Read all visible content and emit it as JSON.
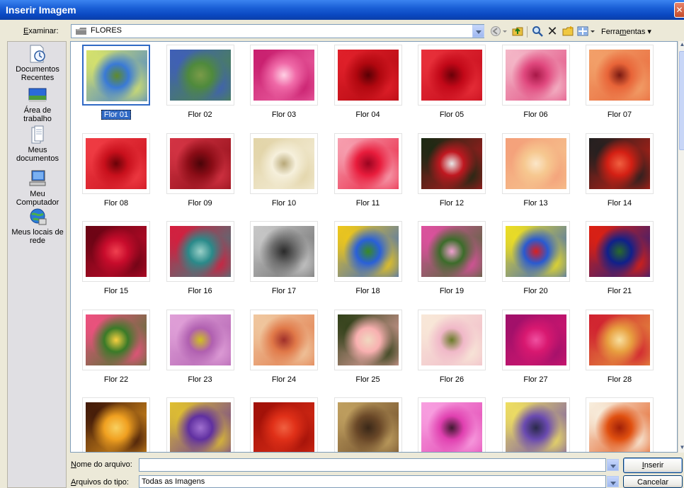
{
  "window": {
    "title": "Inserir Imagem",
    "close_glyph": "✕"
  },
  "toolbar": {
    "look_in_label": "Examinar:",
    "look_in_underline": "E",
    "look_in_rest": "xaminar:",
    "current_folder": "FLORES",
    "tools_label": "Ferramentas",
    "tools_pre": "Ferra",
    "tools_underline": "m",
    "tools_post": "entas ▾",
    "delete_glyph": "✕"
  },
  "places": [
    {
      "line1": "Documentos",
      "line2": "Recentes",
      "icon": "recent-documents-icon"
    },
    {
      "line1": "Área de",
      "line2": "trabalho",
      "icon": "desktop-icon"
    },
    {
      "line1": "Meus",
      "line2": "documentos",
      "icon": "my-documents-icon"
    },
    {
      "line1": "Meu",
      "line2": "Computador",
      "icon": "my-computer-icon"
    },
    {
      "line1": "Meus locais de",
      "line2": "rede",
      "icon": "network-places-icon"
    }
  ],
  "files": [
    {
      "name": "Flor 01",
      "selected": true,
      "colors": [
        "#3a7ad6",
        "#d8e36a",
        "#5f8a2a"
      ]
    },
    {
      "name": "Flor 02",
      "selected": false,
      "colors": [
        "#4f8a3c",
        "#3f5fb8",
        "#7a9b48"
      ]
    },
    {
      "name": "Flor 03",
      "selected": false,
      "colors": [
        "#f06aa8",
        "#c81e6e",
        "#ffd0e4"
      ]
    },
    {
      "name": "Flor 04",
      "selected": false,
      "colors": [
        "#b0070f",
        "#e0202a",
        "#5a0005"
      ]
    },
    {
      "name": "Flor 05",
      "selected": false,
      "colors": [
        "#c20818",
        "#e8303a",
        "#6a0008"
      ]
    },
    {
      "name": "Flor 06",
      "selected": false,
      "colors": [
        "#e0487e",
        "#f4b8c8",
        "#a81848"
      ]
    },
    {
      "name": "Flor 07",
      "selected": false,
      "colors": [
        "#e86438",
        "#f2a16a",
        "#7a1a12"
      ]
    },
    {
      "name": "Flor 08",
      "selected": false,
      "colors": [
        "#c8101c",
        "#f03c44",
        "#6a0208"
      ]
    },
    {
      "name": "Flor 09",
      "selected": false,
      "colors": [
        "#8a0c16",
        "#d43444",
        "#4a0408"
      ]
    },
    {
      "name": "Flor 10",
      "selected": false,
      "colors": [
        "#f6f0dc",
        "#e2d4a8",
        "#b8a878"
      ]
    },
    {
      "name": "Flor 11",
      "selected": false,
      "colors": [
        "#e81c3c",
        "#f6a0b0",
        "#9a0420"
      ]
    },
    {
      "name": "Flor 12",
      "selected": false,
      "colors": [
        "#c01820",
        "#1a2a14",
        "#e8e8e8"
      ]
    },
    {
      "name": "Flor 13",
      "selected": false,
      "colors": [
        "#f6c890",
        "#f4a07a",
        "#fbe6c8"
      ]
    },
    {
      "name": "Flor 14",
      "selected": false,
      "colors": [
        "#d42014",
        "#202020",
        "#f06040"
      ]
    },
    {
      "name": "Flor 15",
      "selected": false,
      "colors": [
        "#c80c2c",
        "#6a0414",
        "#f04050"
      ]
    },
    {
      "name": "Flor 16",
      "selected": false,
      "colors": [
        "#2a8a8a",
        "#d81c3c",
        "#9ad0c8"
      ]
    },
    {
      "name": "Flor 17",
      "selected": false,
      "colors": [
        "#6a6a6a",
        "#c8c8c8",
        "#2a2a2a"
      ]
    },
    {
      "name": "Flor 18",
      "selected": false,
      "colors": [
        "#2a60d8",
        "#f0c818",
        "#3a8a24"
      ]
    },
    {
      "name": "Flor 19",
      "selected": false,
      "colors": [
        "#3c6c2a",
        "#e050a0",
        "#f0a0d0"
      ]
    },
    {
      "name": "Flor 20",
      "selected": false,
      "colors": [
        "#2a5ad0",
        "#f0e020",
        "#d82020"
      ]
    },
    {
      "name": "Flor 21",
      "selected": false,
      "colors": [
        "#10208a",
        "#e02010",
        "#2a6a2a"
      ]
    },
    {
      "name": "Flor 22",
      "selected": false,
      "colors": [
        "#3a7a28",
        "#f05080",
        "#f8d040"
      ]
    },
    {
      "name": "Flor 23",
      "selected": false,
      "colors": [
        "#b060b0",
        "#e0a0d8",
        "#d0c020"
      ]
    },
    {
      "name": "Flor 24",
      "selected": false,
      "colors": [
        "#e07848",
        "#f0c8a0",
        "#a0302a"
      ]
    },
    {
      "name": "Flor 25",
      "selected": false,
      "colors": [
        "#f8b0b0",
        "#304018",
        "#f0d8c0"
      ]
    },
    {
      "name": "Flor 26",
      "selected": false,
      "colors": [
        "#f0b8c8",
        "#f8e8d8",
        "#6a7a28"
      ]
    },
    {
      "name": "Flor 27",
      "selected": false,
      "colors": [
        "#d81870",
        "#a0106a",
        "#f050a0"
      ]
    },
    {
      "name": "Flor 28",
      "selected": false,
      "colors": [
        "#e8a040",
        "#d02030",
        "#f8e0a0"
      ]
    },
    {
      "name": "",
      "selected": false,
      "colors": [
        "#f0a020",
        "#401808",
        "#f8d060"
      ]
    },
    {
      "name": "",
      "selected": false,
      "colors": [
        "#6030a0",
        "#e0c030",
        "#a070d0"
      ]
    },
    {
      "name": "",
      "selected": false,
      "colors": [
        "#e03018",
        "#a01008",
        "#f06040"
      ]
    },
    {
      "name": "",
      "selected": false,
      "colors": [
        "#6a4828",
        "#c0a060",
        "#3a2818"
      ]
    },
    {
      "name": "",
      "selected": false,
      "colors": [
        "#e040b0",
        "#f8a0e0",
        "#401830"
      ]
    },
    {
      "name": "",
      "selected": false,
      "colors": [
        "#6a4ab0",
        "#f0e060",
        "#2a2a4a"
      ]
    },
    {
      "name": "",
      "selected": false,
      "colors": [
        "#e05010",
        "#f8f0e0",
        "#a02008"
      ]
    }
  ],
  "bottom": {
    "filename_label_u": "N",
    "filename_label_rest": "ome do arquivo:",
    "filename_value": "",
    "filetype_label_u": "A",
    "filetype_label_rest": "rquivos do tipo:",
    "filetype_value": "Todas as Imagens",
    "insert_u": "I",
    "insert_rest": "nserir",
    "cancel_label": "Cancelar"
  }
}
